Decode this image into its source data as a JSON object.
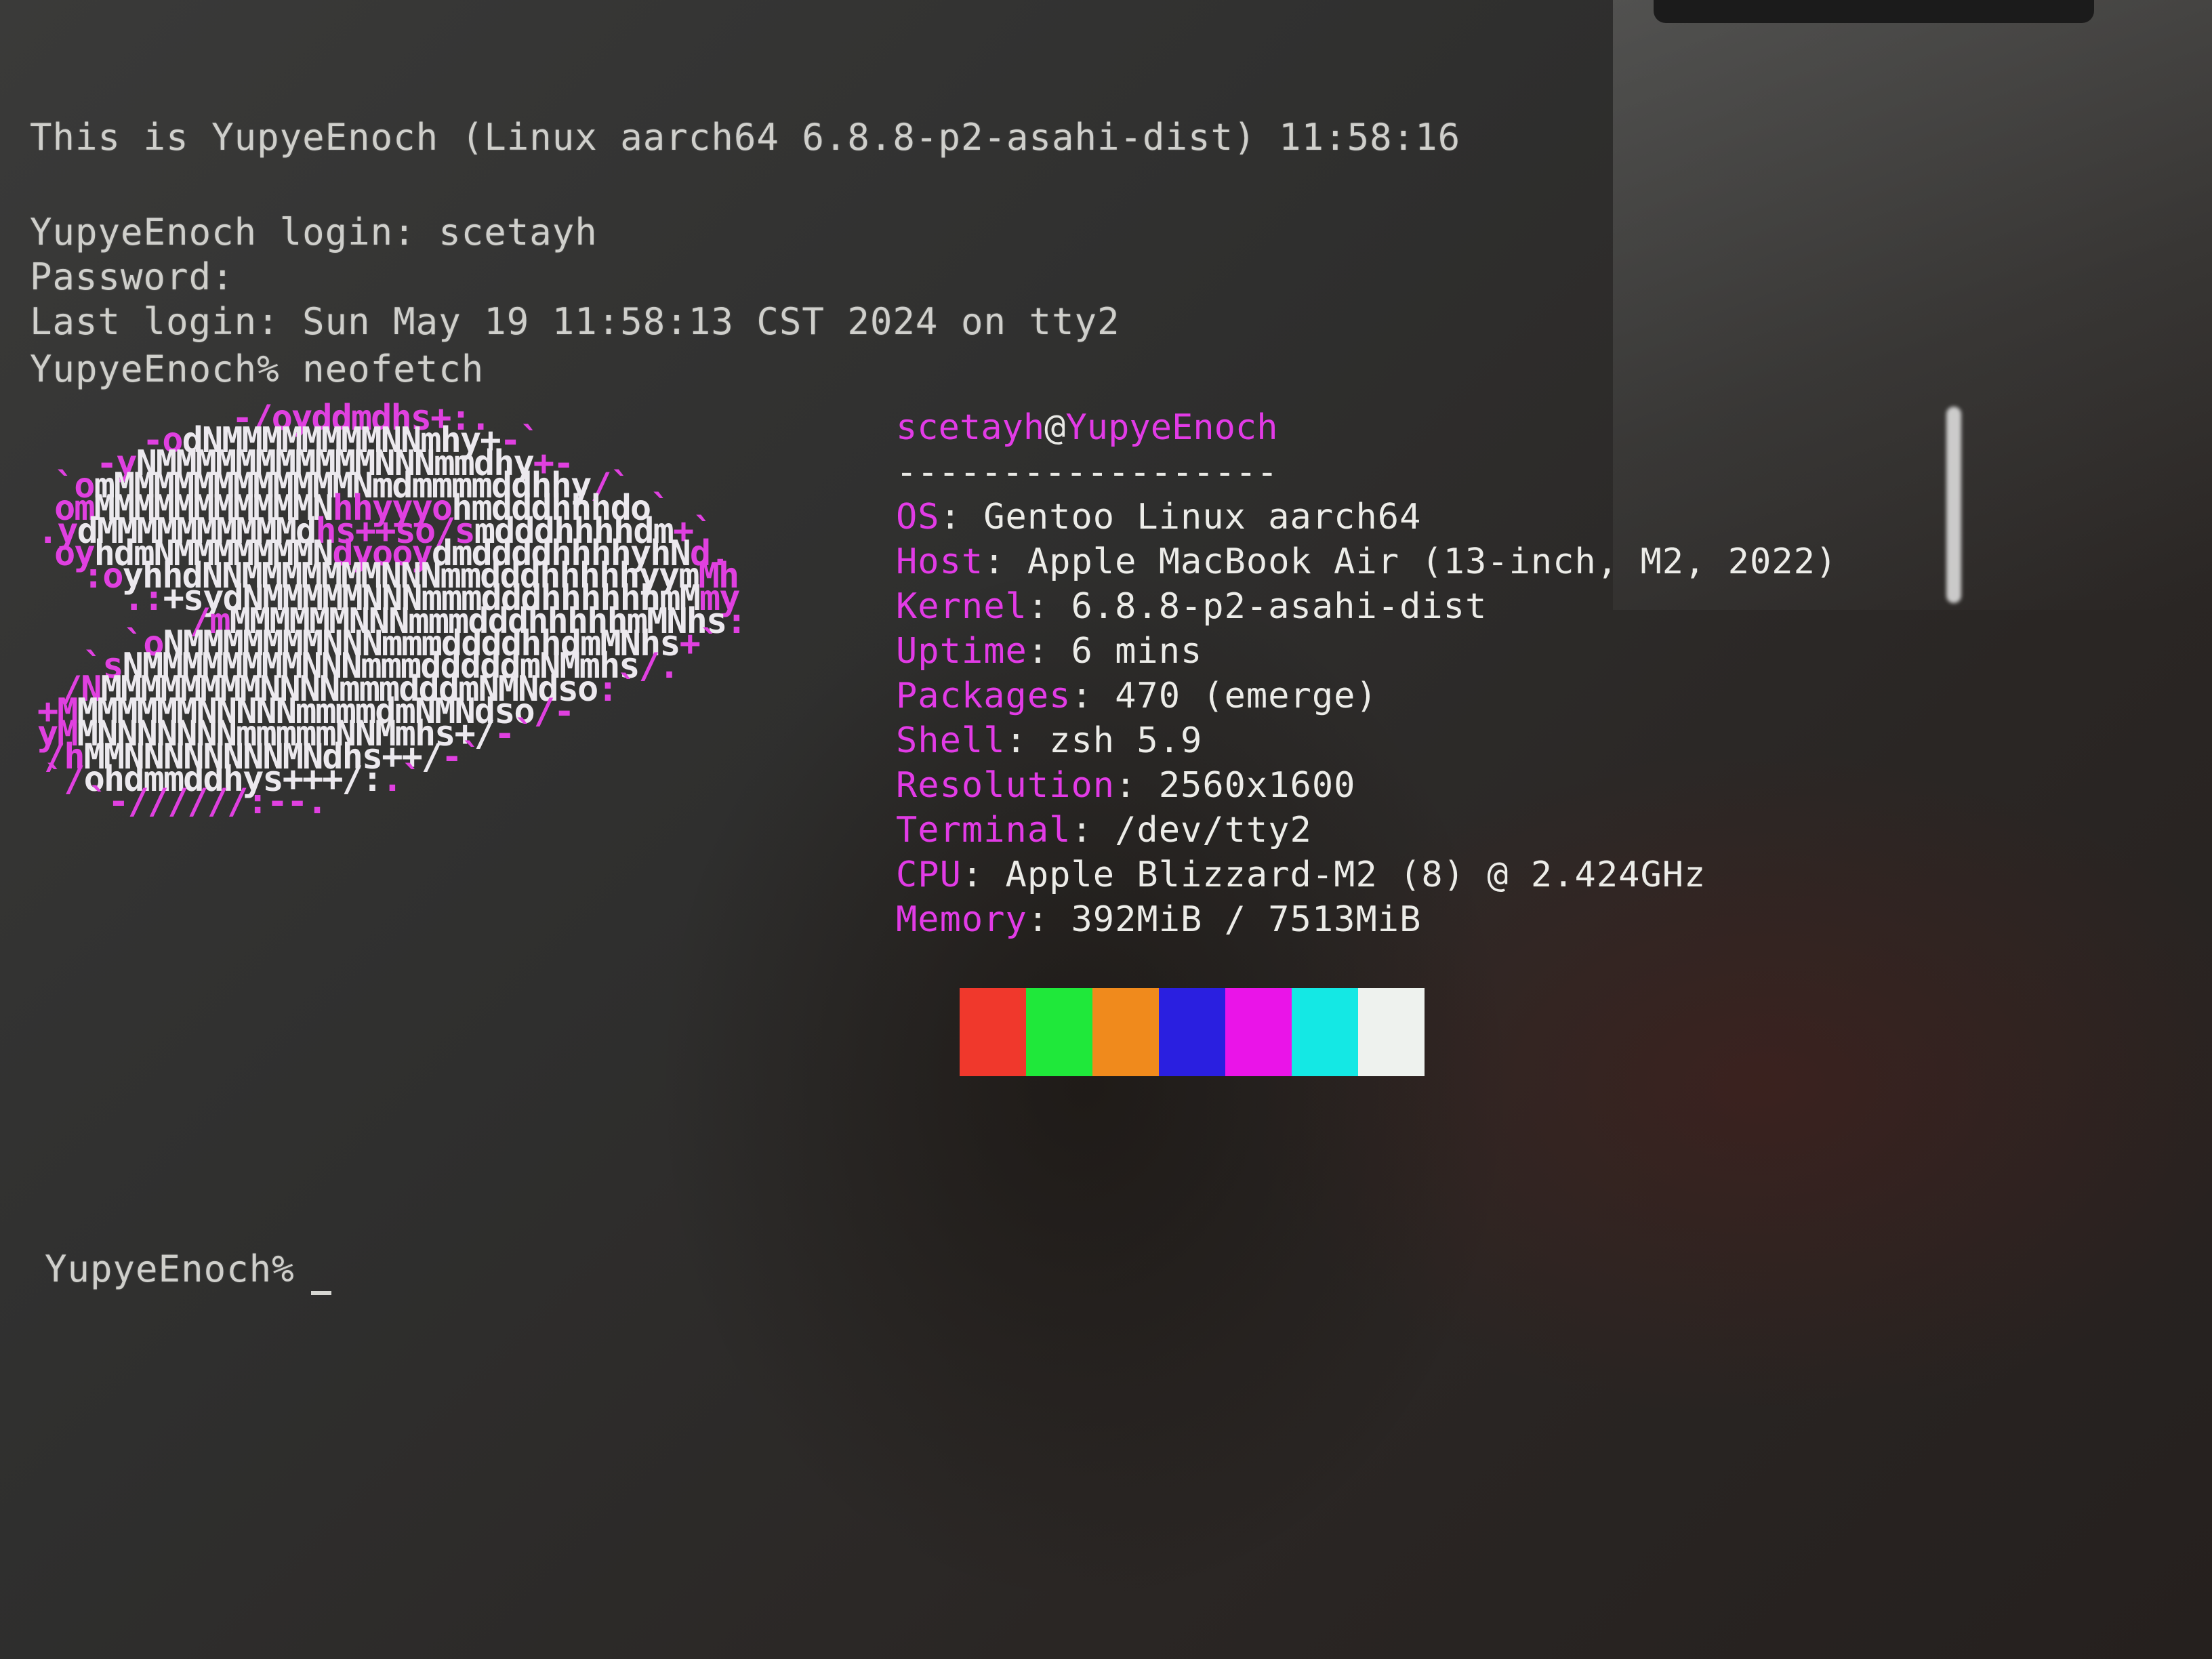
{
  "terminal": {
    "banner": "This is YupyeEnoch (Linux aarch64 6.8.8-p2-asahi-dist) 11:58:16",
    "login_line": "YupyeEnoch login: scetayh",
    "password_line": "Password:",
    "last_login_line": "Last login: Sun May 19 11:58:13 CST 2024 on tty2",
    "command_prompt": "YupyeEnoch%",
    "command": "neofetch",
    "final_prompt": "YupyeEnoch%"
  },
  "neofetch": {
    "user": "scetayh",
    "at": "@",
    "host": "YupyeEnoch",
    "divider": "------------------",
    "info": [
      {
        "key": "OS",
        "value": "Gentoo Linux aarch64"
      },
      {
        "key": "Host",
        "value": "Apple MacBook Air (13-inch, M2, 2022)"
      },
      {
        "key": "Kernel",
        "value": "6.8.8-p2-asahi-dist"
      },
      {
        "key": "Uptime",
        "value": "6 mins"
      },
      {
        "key": "Packages",
        "value": "470 (emerge)"
      },
      {
        "key": "Shell",
        "value": "zsh 5.9"
      },
      {
        "key": "Resolution",
        "value": "2560x1600"
      },
      {
        "key": "Terminal",
        "value": "/dev/tty2"
      },
      {
        "key": "CPU",
        "value": "Apple Blizzard-M2 (8) @ 2.424GHz"
      },
      {
        "key": "Memory",
        "value": "392MiB / 7513MiB"
      }
    ],
    "logo": [
      [
        [
          "m",
          "-/oyddmdhs+:."
        ]
      ],
      [
        [
          "m",
          "-o"
        ],
        [
          "w",
          "dNMMMMMMMMNNmhy+"
        ],
        [
          "m",
          "-`"
        ]
      ],
      [
        [
          "m",
          "-y"
        ],
        [
          "w",
          "NMMMMMMMMMMMNNNmmdhy"
        ],
        [
          "m",
          "+-"
        ]
      ],
      [
        [
          "m",
          "`o"
        ],
        [
          "w",
          "mMMMMMMMMMMMMNmdmmmmddhhy"
        ],
        [
          "m",
          "/`"
        ]
      ],
      [
        [
          "m",
          "om"
        ],
        [
          "w",
          "MMMMMMMMMMMN"
        ],
        [
          "m",
          "hhyyyo"
        ],
        [
          "w",
          "hmdddhhhdo"
        ],
        [
          "m",
          "`"
        ]
      ],
      [
        [
          "m",
          ".y"
        ],
        [
          "w",
          "dMMMMMMMMMMd"
        ],
        [
          "m",
          "hs++so/s"
        ],
        [
          "w",
          "mdddhhhhdm"
        ],
        [
          "m",
          "+`"
        ]
      ],
      [
        [
          "m",
          "oy"
        ],
        [
          "w",
          "hdmNMMMMMMMN"
        ],
        [
          "m",
          "dyooy"
        ],
        [
          "w",
          "dmddddhhhhyhN"
        ],
        [
          "m",
          "d."
        ]
      ],
      [
        [
          "m",
          ":o"
        ],
        [
          "w",
          "yhhdNNMMMMMMMNNNmmdddhhhhhyym"
        ],
        [
          "m",
          "Mh"
        ]
      ],
      [
        [
          "m",
          ".:"
        ],
        [
          "w",
          "+sydNMMMMMNNNmmmdddhhhhhhmM"
        ],
        [
          "m",
          "my"
        ]
      ],
      [
        [
          "m",
          "/m"
        ],
        [
          "w",
          "MMMMMMNNNmmmdddhhhhhmMNhs"
        ],
        [
          "m",
          ":"
        ]
      ],
      [
        [
          "m",
          "`o"
        ],
        [
          "w",
          "NMMMMMMMNNNmmmddddhhdmMNhs"
        ],
        [
          "m",
          "+`"
        ]
      ],
      [
        [
          "m",
          "`s"
        ],
        [
          "w",
          "NMMMMMMMMNNNmmmdddddmNMmhs"
        ],
        [
          "m",
          "/."
        ]
      ],
      [
        [
          "m",
          "/N"
        ],
        [
          "w",
          "MMMMMMMMNNNNmmmdddmNMNdso"
        ],
        [
          "m",
          ":`"
        ]
      ],
      [
        [
          "m",
          "+M"
        ],
        [
          "w",
          "MMMMMMNNNNNmmmmdmNMNdso"
        ],
        [
          "m",
          "/-"
        ]
      ],
      [
        [
          "m",
          "yM"
        ],
        [
          "w",
          "MNNNNNNNmmmmmNNMmhs+/"
        ],
        [
          "m",
          "-`"
        ]
      ],
      [
        [
          "m",
          "/h"
        ],
        [
          "w",
          "MMNNNNNNNNMNdhs++/"
        ],
        [
          "m",
          "-`"
        ]
      ],
      [
        [
          "m",
          "`/"
        ],
        [
          "w",
          "ohdmmddhys+++/:"
        ],
        [
          "m",
          ".`"
        ]
      ],
      [
        [
          "m",
          "`-//////:--."
        ]
      ]
    ],
    "palette": [
      "#f0382c",
      "#1fe83a",
      "#f08a1c",
      "#2a1fe0",
      "#ea14e8",
      "#14e8e4",
      "#eef2ee"
    ]
  }
}
